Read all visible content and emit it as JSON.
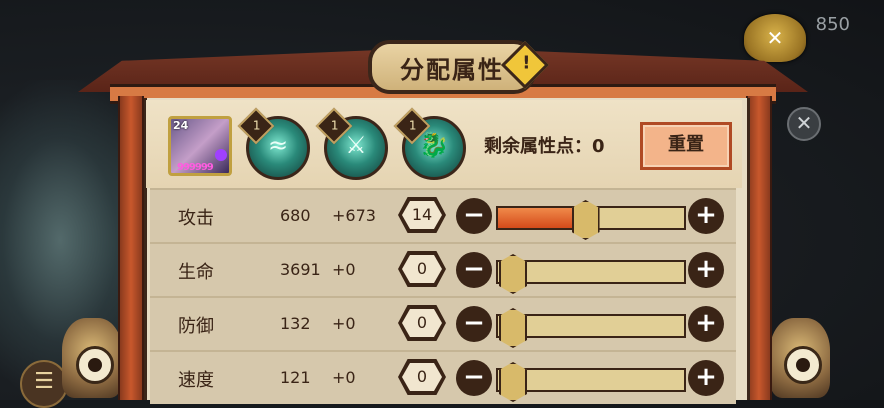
{
  "hud": {
    "counter": "850",
    "menu_glyph": "☰",
    "close_glyph": "✕",
    "gourd_glyph": "✕"
  },
  "header": {
    "title": "分配属性",
    "warn_glyph": "!"
  },
  "character": {
    "level": "24",
    "stars": "999999"
  },
  "souls": [
    {
      "level": "1",
      "glyph": "≈"
    },
    {
      "level": "1",
      "glyph": "⚔"
    },
    {
      "level": "1",
      "glyph": "🐉"
    }
  ],
  "remaining": {
    "label": "剩余属性点：0"
  },
  "reset_label": "重置",
  "attributes": [
    {
      "name": "攻击",
      "base": "680",
      "bonus": "+673",
      "points": "14",
      "fill_fraction": 0.46
    },
    {
      "name": "生命",
      "base": "3691",
      "bonus": "+0",
      "points": "0",
      "fill_fraction": 0.0
    },
    {
      "name": "防御",
      "base": "132",
      "bonus": "+0",
      "points": "0",
      "fill_fraction": 0.0
    },
    {
      "name": "速度",
      "base": "121",
      "bonus": "+0",
      "points": "0",
      "fill_fraction": 0.0
    }
  ],
  "buttons": {
    "minus": "−",
    "plus": "+"
  }
}
